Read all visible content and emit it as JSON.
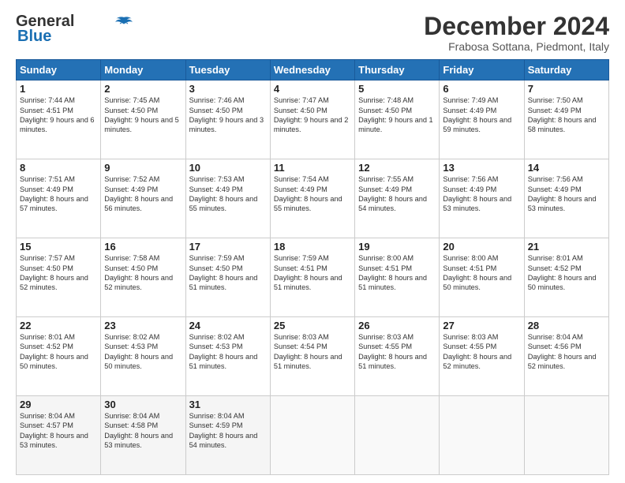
{
  "header": {
    "logo_line1": "General",
    "logo_line2": "Blue",
    "month_title": "December 2024",
    "location": "Frabosa Sottana, Piedmont, Italy"
  },
  "days_of_week": [
    "Sunday",
    "Monday",
    "Tuesday",
    "Wednesday",
    "Thursday",
    "Friday",
    "Saturday"
  ],
  "weeks": [
    [
      {
        "day": "1",
        "sunrise": "7:44 AM",
        "sunset": "4:51 PM",
        "daylight": "9 hours and 6 minutes."
      },
      {
        "day": "2",
        "sunrise": "7:45 AM",
        "sunset": "4:50 PM",
        "daylight": "9 hours and 5 minutes."
      },
      {
        "day": "3",
        "sunrise": "7:46 AM",
        "sunset": "4:50 PM",
        "daylight": "9 hours and 3 minutes."
      },
      {
        "day": "4",
        "sunrise": "7:47 AM",
        "sunset": "4:50 PM",
        "daylight": "9 hours and 2 minutes."
      },
      {
        "day": "5",
        "sunrise": "7:48 AM",
        "sunset": "4:50 PM",
        "daylight": "9 hours and 1 minute."
      },
      {
        "day": "6",
        "sunrise": "7:49 AM",
        "sunset": "4:49 PM",
        "daylight": "8 hours and 59 minutes."
      },
      {
        "day": "7",
        "sunrise": "7:50 AM",
        "sunset": "4:49 PM",
        "daylight": "8 hours and 58 minutes."
      }
    ],
    [
      {
        "day": "8",
        "sunrise": "7:51 AM",
        "sunset": "4:49 PM",
        "daylight": "8 hours and 57 minutes."
      },
      {
        "day": "9",
        "sunrise": "7:52 AM",
        "sunset": "4:49 PM",
        "daylight": "8 hours and 56 minutes."
      },
      {
        "day": "10",
        "sunrise": "7:53 AM",
        "sunset": "4:49 PM",
        "daylight": "8 hours and 55 minutes."
      },
      {
        "day": "11",
        "sunrise": "7:54 AM",
        "sunset": "4:49 PM",
        "daylight": "8 hours and 55 minutes."
      },
      {
        "day": "12",
        "sunrise": "7:55 AM",
        "sunset": "4:49 PM",
        "daylight": "8 hours and 54 minutes."
      },
      {
        "day": "13",
        "sunrise": "7:56 AM",
        "sunset": "4:49 PM",
        "daylight": "8 hours and 53 minutes."
      },
      {
        "day": "14",
        "sunrise": "7:56 AM",
        "sunset": "4:49 PM",
        "daylight": "8 hours and 53 minutes."
      }
    ],
    [
      {
        "day": "15",
        "sunrise": "7:57 AM",
        "sunset": "4:50 PM",
        "daylight": "8 hours and 52 minutes."
      },
      {
        "day": "16",
        "sunrise": "7:58 AM",
        "sunset": "4:50 PM",
        "daylight": "8 hours and 52 minutes."
      },
      {
        "day": "17",
        "sunrise": "7:59 AM",
        "sunset": "4:50 PM",
        "daylight": "8 hours and 51 minutes."
      },
      {
        "day": "18",
        "sunrise": "7:59 AM",
        "sunset": "4:51 PM",
        "daylight": "8 hours and 51 minutes."
      },
      {
        "day": "19",
        "sunrise": "8:00 AM",
        "sunset": "4:51 PM",
        "daylight": "8 hours and 51 minutes."
      },
      {
        "day": "20",
        "sunrise": "8:00 AM",
        "sunset": "4:51 PM",
        "daylight": "8 hours and 50 minutes."
      },
      {
        "day": "21",
        "sunrise": "8:01 AM",
        "sunset": "4:52 PM",
        "daylight": "8 hours and 50 minutes."
      }
    ],
    [
      {
        "day": "22",
        "sunrise": "8:01 AM",
        "sunset": "4:52 PM",
        "daylight": "8 hours and 50 minutes."
      },
      {
        "day": "23",
        "sunrise": "8:02 AM",
        "sunset": "4:53 PM",
        "daylight": "8 hours and 50 minutes."
      },
      {
        "day": "24",
        "sunrise": "8:02 AM",
        "sunset": "4:53 PM",
        "daylight": "8 hours and 51 minutes."
      },
      {
        "day": "25",
        "sunrise": "8:03 AM",
        "sunset": "4:54 PM",
        "daylight": "8 hours and 51 minutes."
      },
      {
        "day": "26",
        "sunrise": "8:03 AM",
        "sunset": "4:55 PM",
        "daylight": "8 hours and 51 minutes."
      },
      {
        "day": "27",
        "sunrise": "8:03 AM",
        "sunset": "4:55 PM",
        "daylight": "8 hours and 52 minutes."
      },
      {
        "day": "28",
        "sunrise": "8:04 AM",
        "sunset": "4:56 PM",
        "daylight": "8 hours and 52 minutes."
      }
    ],
    [
      {
        "day": "29",
        "sunrise": "8:04 AM",
        "sunset": "4:57 PM",
        "daylight": "8 hours and 53 minutes."
      },
      {
        "day": "30",
        "sunrise": "8:04 AM",
        "sunset": "4:58 PM",
        "daylight": "8 hours and 53 minutes."
      },
      {
        "day": "31",
        "sunrise": "8:04 AM",
        "sunset": "4:59 PM",
        "daylight": "8 hours and 54 minutes."
      },
      null,
      null,
      null,
      null
    ]
  ]
}
